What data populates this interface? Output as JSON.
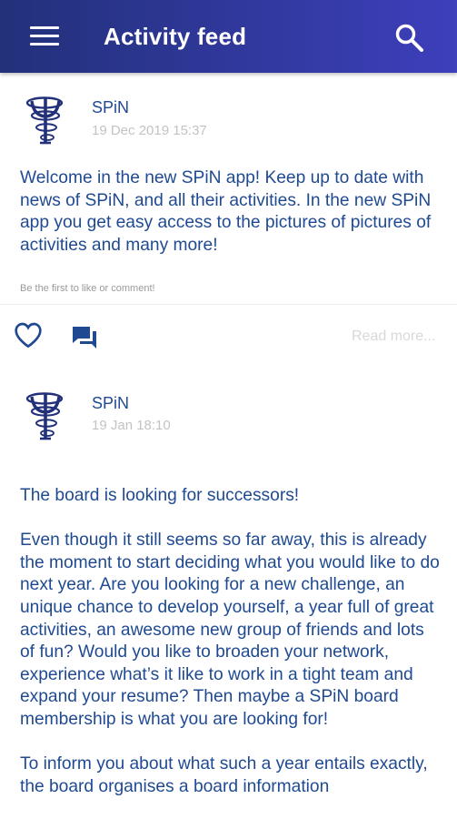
{
  "appbar": {
    "title": "Activity feed",
    "menu_icon": "menu-icon",
    "search_icon": "search-icon",
    "color_start": "#22317a",
    "color_end": "#3d3fbb"
  },
  "posts": [
    {
      "author": "SPiN",
      "timestamp": "19 Dec 2019 15:37",
      "text": "Welcome in the new SPiN app! Keep up to date with news of SPiN, and all their activities. In the new SPiN app you get easy access to the pictures of pictures of activities and many more!",
      "hint": "Be the first to like or comment!",
      "actions": {
        "like_icon": "heart-icon",
        "comment_icon": "comment-icon",
        "read_more": "Read more..."
      }
    },
    {
      "author": "SPiN",
      "timestamp": "19 Jan 18:10",
      "text": "The board is looking for successors!\n\nEven though it still seems so far away, this is already the moment to start deciding what you would like to do next year. Are you looking for a new challenge, an unique chance to develop yourself, a year full of great activities, an awesome new group of friends and lots of fun? Would you like to broaden your network, experience what’s it like to work in a tight team and expand your resume? Then maybe a SPiN board membership is what you are looking for!\n\nTo inform you about what such a year entails exactly, the board organises a board information"
    }
  ],
  "colors": {
    "text": "#1f4a92",
    "muted": "#c3c3c3"
  }
}
